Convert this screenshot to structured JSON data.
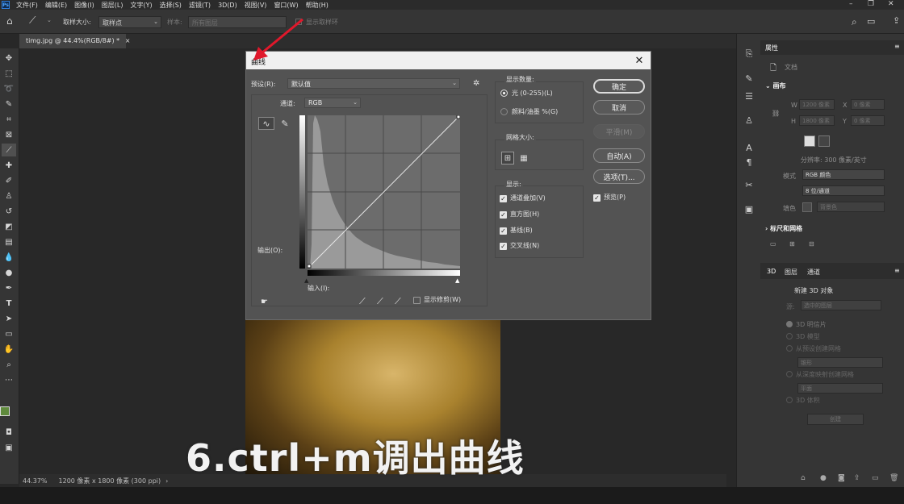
{
  "menubar": {
    "logo": "Ps",
    "items": [
      "文件(F)",
      "编辑(E)",
      "图像(I)",
      "图层(L)",
      "文字(Y)",
      "选择(S)",
      "滤镜(T)",
      "3D(D)",
      "视图(V)",
      "窗口(W)",
      "帮助(H)"
    ]
  },
  "options": {
    "sample_size_label": "取样大小:",
    "sample_size_value": "取样点",
    "sample_label": "样本:",
    "sample_value": "所有图层",
    "show_ring_label": "显示取样环"
  },
  "doc_tab": {
    "title": "timg.jpg @ 44.4%(RGB/8#) *",
    "close": "×"
  },
  "status": {
    "zoom": "44.37%",
    "info": "1200 像素 x 1800 像素 (300 ppi)",
    "arrow": "›"
  },
  "subtitle": "6.ctrl+m调出曲线",
  "dialog": {
    "title": "曲线",
    "preset_label": "预设(R):",
    "preset_value": "默认值",
    "channel_label": "通道:",
    "channel_value": "RGB",
    "output_label": "输出(O):",
    "input_label": "输入(I):",
    "show_clipping": "显示修剪(W)",
    "show_amount_title": "显示数量:",
    "radio_light": "光 (0-255)(L)",
    "radio_pigment": "颜料/油墨 %(G)",
    "grid_size_title": "网格大小:",
    "display_title": "显示:",
    "display_options": [
      "通道叠加(V)",
      "直方图(H)",
      "基线(B)",
      "交叉线(N)"
    ],
    "preview": "预览(P)",
    "buttons": {
      "ok": "确定",
      "cancel": "取消",
      "smooth": "平滑(M)",
      "auto": "自动(A)",
      "options": "选项(T)..."
    }
  },
  "properties": {
    "tab_properties": "属性",
    "doc_label": "文档",
    "canvas_title": "画布",
    "w_label": "W",
    "w_value": "1200 像素",
    "h_label": "H",
    "h_value": "1800 像素",
    "x_label": "X",
    "x_value": "0 像素",
    "y_label": "Y",
    "y_value": "0 像素",
    "resolution": "分辨率: 300 像素/英寸",
    "mode_label": "模式",
    "mode_value": "RGB 颜色",
    "depth_value": "8 位/通道",
    "fill_label": "填色",
    "fill_value": "背景色",
    "rulers_title": "标尺和网格"
  },
  "panel3d": {
    "tabs": [
      "3D",
      "图层",
      "通道"
    ],
    "new_object": "新建 3D 对象",
    "source_label": "源:",
    "source_value": "选中的图层",
    "opt_postcard": "3D 明信片",
    "opt_model": "3D 模型",
    "opt_preset_mesh": "从预设创建网格",
    "preset_value": "锥形",
    "opt_depth_map": "从深度映射创建网格",
    "depth_value": "平面",
    "opt_volume": "3D 体积",
    "create_btn": "创建"
  },
  "colors": {
    "highlight_arrow": "#e0182b",
    "foreground": "#5f8a3c",
    "background": "#ffffff"
  },
  "curve_graph": {
    "curve_points": [
      [
        0,
        0
      ],
      [
        255,
        255
      ]
    ],
    "histogram_description": "dark-heavy"
  }
}
